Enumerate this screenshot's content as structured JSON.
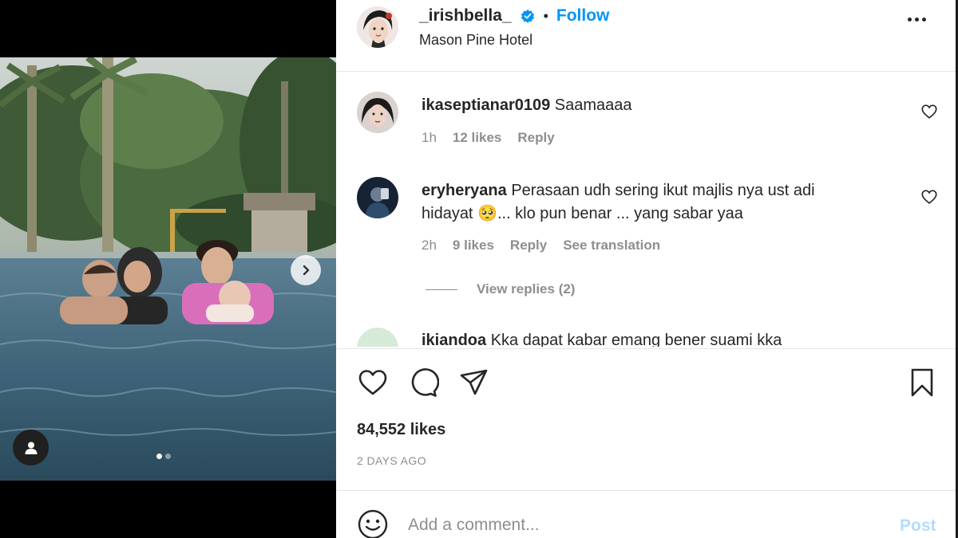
{
  "post": {
    "username": "_irishbella_",
    "follow_label": "Follow",
    "separator": "•",
    "location": "Mason Pine Hotel",
    "verified_icon": "verified-badge-icon",
    "more_icon": "more-options-icon"
  },
  "comments": [
    {
      "username": "ikaseptianar0109",
      "text": "Saamaaaa",
      "time": "1h",
      "likes": "12 likes",
      "reply": "Reply"
    },
    {
      "username": "eryheryana",
      "text": "Perasaan udh sering ikut majlis nya ust adi hidayat 🥺... klo pun benar ... yang sabar yaa",
      "time": "2h",
      "likes": "9 likes",
      "reply": "Reply",
      "translate": "See translation",
      "view_replies": "View replies (2)"
    },
    {
      "username": "ikiandoa",
      "text": "Kka dapat kabar emang bener suami kka"
    }
  ],
  "actions": {
    "likes": "84,552 likes",
    "date": "2 DAYS AGO"
  },
  "composer": {
    "placeholder": "Add a comment...",
    "post_label": "Post"
  },
  "media": {
    "carousel_position": 1,
    "carousel_count": 2
  },
  "colors": {
    "accent": "#0095f6",
    "post_disabled": "#b3dbff",
    "secondary_text": "#8e8e8e",
    "primary_text": "#262626"
  }
}
